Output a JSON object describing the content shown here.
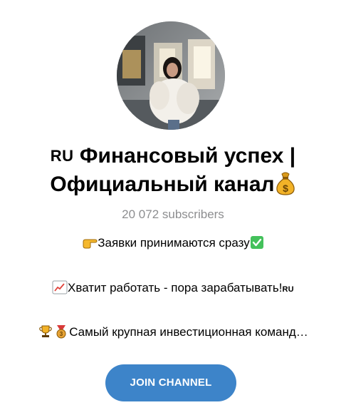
{
  "channel": {
    "title_flag": "RU",
    "title_line1": "Финансовый успех |",
    "title_line2": "Официальный канал",
    "title_icon": "money-bag-icon",
    "subscribers": "20 072 subscribers"
  },
  "description": {
    "line1": {
      "icon": "backhand-index-pointing-right-icon",
      "text": "Заявки принимаются сразу",
      "end_icon": "check-mark-button-icon"
    },
    "line2": {
      "icon": "chart-increasing-icon",
      "text": "Хватит работать - пора зарабатывать!",
      "end_flag": "RU"
    },
    "line3": {
      "icons": [
        "trophy-icon",
        "medal-icon"
      ],
      "text": "Самый крупная инвестиционная команд…"
    }
  },
  "actions": {
    "join_label": "JOIN CHANNEL"
  },
  "colors": {
    "accent": "#3d84c9",
    "muted_text": "#8d8e90",
    "check_green": "#44c15b"
  }
}
